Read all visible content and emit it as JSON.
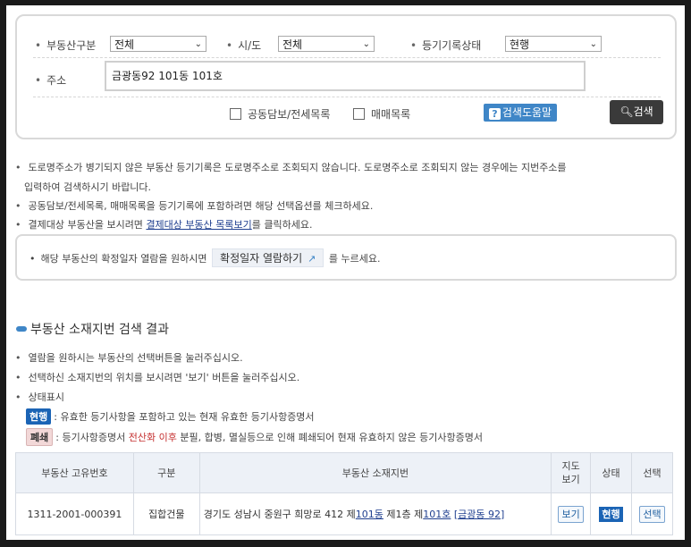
{
  "search": {
    "property_type_label": "부동산구분",
    "property_type_value": "전체",
    "city_label": "시/도",
    "city_value": "전체",
    "record_status_label": "등기기록상태",
    "record_status_value": "현행",
    "address_label": "주소",
    "address_value": "금광동92 101동 101호",
    "joint_collateral_label": "공동담보/전세목록",
    "sale_list_label": "매매목록",
    "help_button_label": "검색도움말",
    "help_icon": "?",
    "search_button_label": "검색"
  },
  "guide": {
    "line1": "도로명주소가 병기되지 않은 부동산 등기기록은 도로명주소로 조회되지 않습니다. 도로명주소로 조회되지 않는 경우에는 지번주소를",
    "line1b": "입력하여 검색하시기 바랍니다.",
    "line2": "공동담보/전세목록, 매매목록을 등기기록에 포함하려면 해당 선택옵션를 체크하세요.",
    "line3_pre": "결제대상 부동산을 보시려면",
    "line3_link": "결제대상 부동산 목록보기",
    "line3_post": "를 클릭하세요."
  },
  "notice": {
    "pre": "해당 부동산의 확정일자 열람을 원하시면",
    "button": "확정일자 열람하기",
    "post": "를 누르세요."
  },
  "results": {
    "title": "부동산 소재지번 검색 결과",
    "note1": "열람을 원하시는 부동산의 선택버튼을 눌러주십시오.",
    "note2": "선택하신 소재지번의 위치를 보시려면 '보기' 버튼을 눌러주십시오.",
    "note3": "상태표시",
    "badge_current": "현행",
    "badge_current_desc": ": 유효한 등기사항을 포함하고 있는 현재 유효한 등기사항증명서",
    "badge_closed": "폐쇄",
    "badge_closed_desc_pre": ": 등기사항증명서",
    "badge_closed_desc_red": "전산화 이후",
    "badge_closed_desc_post": "분필, 합병, 멸실등으로 인해 폐쇄되어 현재 유효하지 않은 등기사항증명서",
    "columns": {
      "id": "부동산 고유번호",
      "type": "구분",
      "address": "부동산 소재지번",
      "map_line1": "지도",
      "map_line2": "보기",
      "status": "상태",
      "select": "선택"
    },
    "rows": [
      {
        "id": "1311-2001-000391",
        "type": "집합건물",
        "addr_pre": "경기도 성남시 중원구 희망로 412 제",
        "addr_link1": "101동",
        "addr_mid": " 제1층 제",
        "addr_link2": "101호",
        "addr_link3": "[금광동 92]",
        "map_button": "보기",
        "status": "현행",
        "select_button": "선택"
      }
    ]
  }
}
